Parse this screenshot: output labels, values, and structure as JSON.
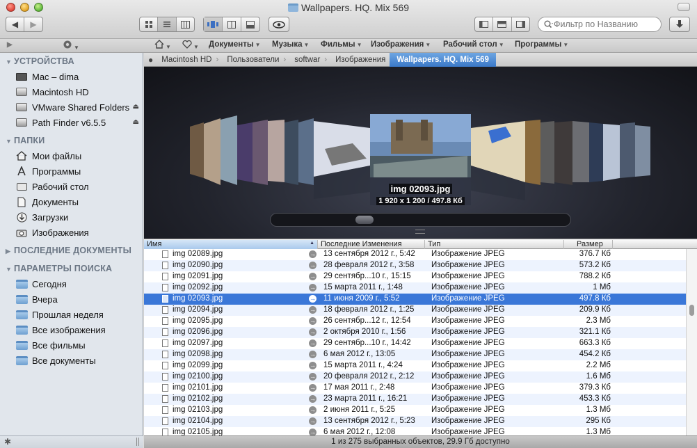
{
  "window": {
    "title": "Wallpapers. HQ. Mix 569"
  },
  "toolbar": {
    "search_placeholder": "Фильтр по Названию"
  },
  "favorites": [
    {
      "label": "Документы"
    },
    {
      "label": "Музыка"
    },
    {
      "label": "Фильмы"
    },
    {
      "label": "Изображения"
    },
    {
      "label": "Рабочий стол"
    },
    {
      "label": "Программы"
    }
  ],
  "path": [
    "Macintosh HD",
    "Пользователи",
    "softwar",
    "Изображения",
    "Wallpapers. HQ. Mix 569"
  ],
  "sidebar": {
    "devices_header": "УСТРОЙСТВА",
    "devices": [
      {
        "label": "Mac – dima",
        "icon": "monitor-icon"
      },
      {
        "label": "Macintosh HD",
        "icon": "hard-drive-icon"
      },
      {
        "label": "VMware Shared Folders",
        "icon": "hard-drive-icon"
      },
      {
        "label": "Path Finder v6.5.5",
        "icon": "hard-drive-icon"
      }
    ],
    "places_header": "ПАПКИ",
    "places": [
      {
        "label": "Мои файлы",
        "icon": "home-icon"
      },
      {
        "label": "Программы",
        "icon": "applications-icon"
      },
      {
        "label": "Рабочий стол",
        "icon": "desktop-icon"
      },
      {
        "label": "Документы",
        "icon": "documents-icon"
      },
      {
        "label": "Загрузки",
        "icon": "downloads-icon"
      },
      {
        "label": "Изображения",
        "icon": "camera-icon"
      }
    ],
    "recent_header": "ПОСЛЕДНИЕ ДОКУМЕНТЫ",
    "search_header": "ПАРАМЕТРЫ ПОИСКА",
    "searches": [
      {
        "label": "Сегодня"
      },
      {
        "label": "Вчера"
      },
      {
        "label": "Прошлая неделя"
      },
      {
        "label": "Все изображения"
      },
      {
        "label": "Все фильмы"
      },
      {
        "label": "Все документы"
      }
    ]
  },
  "coverflow": {
    "name": "img 02093.jpg",
    "info": "1 920 x 1 200 / 497.8 Кб"
  },
  "columns": {
    "name": "Имя",
    "modified": "Последние Изменения",
    "kind": "Тип",
    "size": "Размер"
  },
  "files": [
    {
      "name": "img 02089.jpg",
      "date": "13 сентября 2012 г., 5:42",
      "kind": "Изображение JPEG",
      "size": "376.7 Кб"
    },
    {
      "name": "img 02090.jpg",
      "date": "28 февраля 2012 г., 3:58",
      "kind": "Изображение JPEG",
      "size": "573.2 Кб"
    },
    {
      "name": "img 02091.jpg",
      "date": "29 сентябр...10 г., 15:15",
      "kind": "Изображение JPEG",
      "size": "788.2 Кб"
    },
    {
      "name": "img 02092.jpg",
      "date": "15 марта 2011 г., 1:48",
      "kind": "Изображение JPEG",
      "size": "1 Мб"
    },
    {
      "name": "img 02093.jpg",
      "date": "11 июня 2009 г., 5:52",
      "kind": "Изображение JPEG",
      "size": "497.8 Кб",
      "selected": true
    },
    {
      "name": "img 02094.jpg",
      "date": "18 февраля 2012 г., 1:25",
      "kind": "Изображение JPEG",
      "size": "209.9 Кб"
    },
    {
      "name": "img 02095.jpg",
      "date": "26 сентябр...12 г., 12:54",
      "kind": "Изображение JPEG",
      "size": "2.3 Мб"
    },
    {
      "name": "img 02096.jpg",
      "date": "2 октября 2010 г., 1:56",
      "kind": "Изображение JPEG",
      "size": "321.1 Кб"
    },
    {
      "name": "img 02097.jpg",
      "date": "29 сентябр...10 г., 14:42",
      "kind": "Изображение JPEG",
      "size": "663.3 Кб"
    },
    {
      "name": "img 02098.jpg",
      "date": "6 мая 2012 г., 13:05",
      "kind": "Изображение JPEG",
      "size": "454.2 Кб"
    },
    {
      "name": "img 02099.jpg",
      "date": "15 марта 2011 г., 4:24",
      "kind": "Изображение JPEG",
      "size": "2.2 Мб"
    },
    {
      "name": "img 02100.jpg",
      "date": "20 февраля 2012 г., 2:12",
      "kind": "Изображение JPEG",
      "size": "1.6 Мб"
    },
    {
      "name": "img 02101.jpg",
      "date": "17 мая 2011 г., 2:48",
      "kind": "Изображение JPEG",
      "size": "379.3 Кб"
    },
    {
      "name": "img 02102.jpg",
      "date": "23 марта 2011 г., 16:21",
      "kind": "Изображение JPEG",
      "size": "453.3 Кб"
    },
    {
      "name": "img 02103.jpg",
      "date": "2 июня 2011 г., 5:25",
      "kind": "Изображение JPEG",
      "size": "1.3 Мб"
    },
    {
      "name": "img 02104.jpg",
      "date": "13 сентября 2012 г., 5:23",
      "kind": "Изображение JPEG",
      "size": "295 Кб"
    },
    {
      "name": "img 02105.jpg",
      "date": "6 мая 2012 г., 12:08",
      "kind": "Изображение JPEG",
      "size": "1.3 Мб"
    }
  ],
  "status": {
    "text": "1 из 275 выбранных объектов, 29.9 Гб доступно"
  }
}
